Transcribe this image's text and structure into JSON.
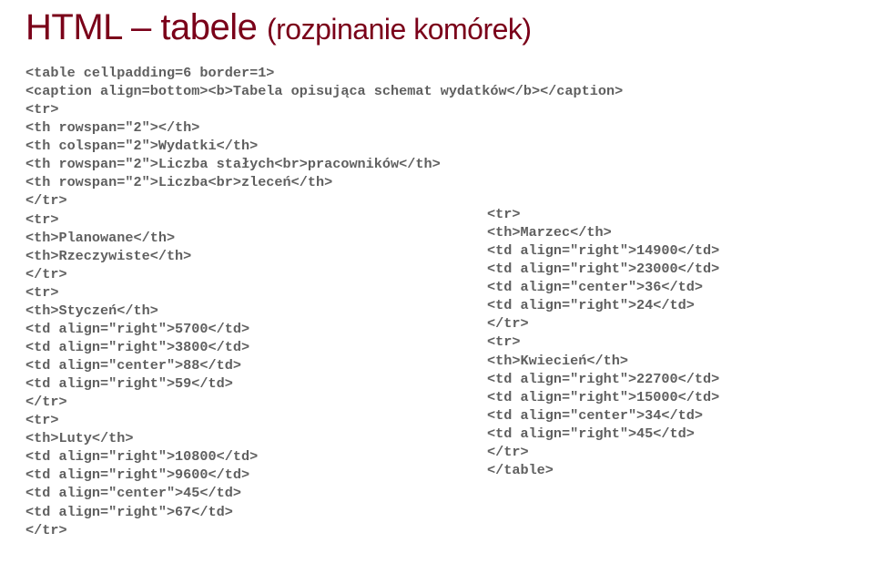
{
  "title_main": "HTML – tabele",
  "title_sub": "(rozpinanie komórek)",
  "code_left": "<table cellpadding=6 border=1>\n<caption align=bottom><b>Tabela opisująca schemat wydatków</b></caption>\n<tr>\n<th rowspan=\"2\"></th>\n<th colspan=\"2\">Wydatki</th>\n<th rowspan=\"2\">Liczba stałych<br>pracowników</th>\n<th rowspan=\"2\">Liczba<br>zleceń</th>\n</tr>\n<tr>\n<th>Planowane</th>\n<th>Rzeczywiste</th>\n</tr>\n<tr>\n<th>Styczeń</th>\n<td align=\"right\">5700</td>\n<td align=\"right\">3800</td>\n<td align=\"center\">88</td>\n<td align=\"right\">59</td>\n</tr>\n<tr>\n<th>Luty</th>\n<td align=\"right\">10800</td>\n<td align=\"right\">9600</td>\n<td align=\"center\">45</td>\n<td align=\"right\">67</td>\n</tr>",
  "code_right": "<tr>\n<th>Marzec</th>\n<td align=\"right\">14900</td>\n<td align=\"right\">23000</td>\n<td align=\"center\">36</td>\n<td align=\"right\">24</td>\n</tr>\n<tr>\n<th>Kwiecień</th>\n<td align=\"right\">22700</td>\n<td align=\"right\">15000</td>\n<td align=\"center\">34</td>\n<td align=\"right\">45</td>\n</tr>\n</table>"
}
